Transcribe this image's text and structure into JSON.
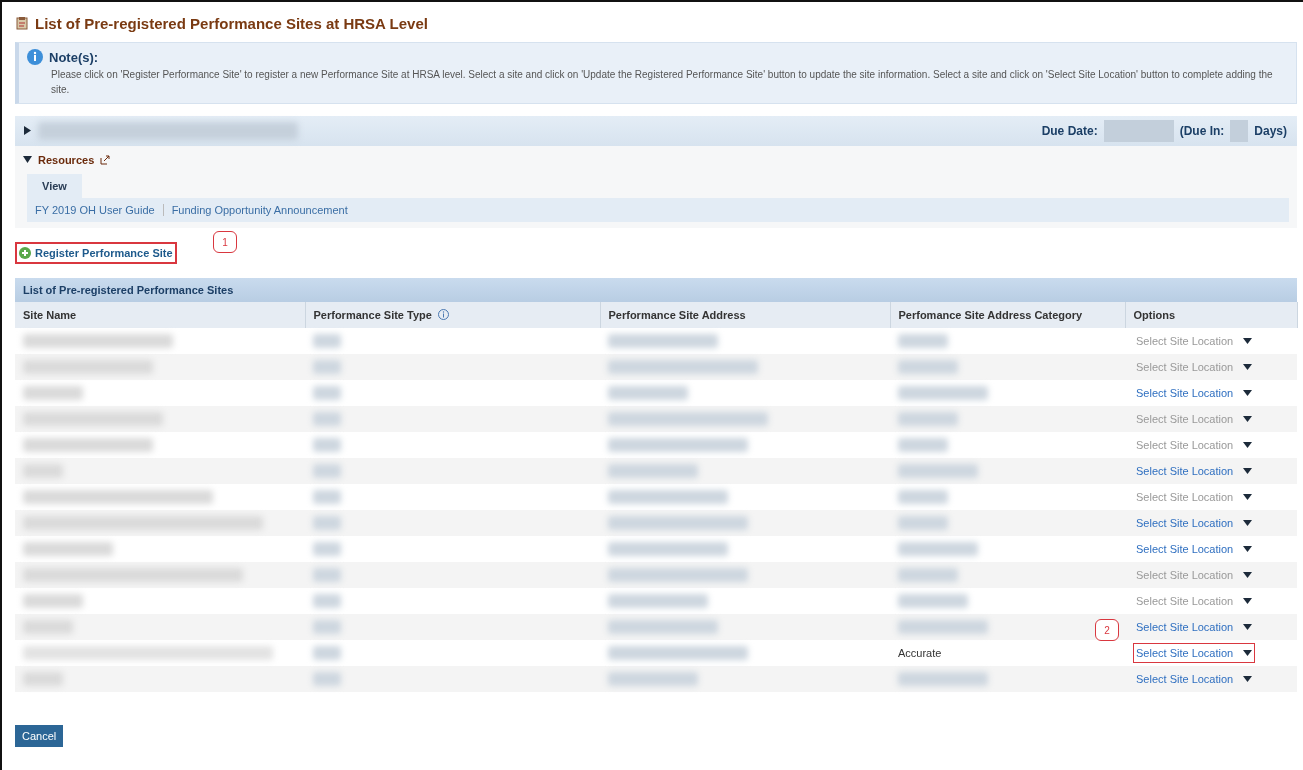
{
  "page": {
    "title": "List of Pre-registered Performance Sites at HRSA Level"
  },
  "note": {
    "heading": "Note(s):",
    "text": "Please click on 'Register Performance Site' to register a new Performance Site at HRSA level. Select a site and click on 'Update the Registered Performance Site' button to update the site information. Select a site and click on 'Select Site Location' button to complete adding the site."
  },
  "summary_bar": {
    "expanded": false,
    "due_date_label": "Due Date:",
    "due_in_label": "(Due In:",
    "days_label": "Days)"
  },
  "resources": {
    "title": "Resources",
    "expanded": true,
    "tab": "View",
    "links": [
      "FY 2019 OH User Guide",
      "Funding Opportunity Announcement"
    ]
  },
  "register_button": {
    "label": "Register Performance Site",
    "callout": "1"
  },
  "table": {
    "title": "List of Pre-registered Performance Sites",
    "columns": [
      "Site Name",
      "Performance Site Type",
      "Performance Site Address",
      "Perfomance Site Address Category",
      "Options"
    ],
    "rows": [
      {
        "option": "Select Site Location",
        "disabled": true
      },
      {
        "option": "Select Site Location",
        "disabled": true
      },
      {
        "option": "Select Site Location",
        "disabled": false
      },
      {
        "option": "Select Site Location",
        "disabled": true
      },
      {
        "option": "Select Site Location",
        "disabled": true
      },
      {
        "option": "Select Site Location",
        "disabled": false
      },
      {
        "option": "Select Site Location",
        "disabled": true
      },
      {
        "option": "Select Site Location",
        "disabled": false
      },
      {
        "option": "Select Site Location",
        "disabled": false
      },
      {
        "option": "Select Site Location",
        "disabled": true
      },
      {
        "option": "Select Site Location",
        "disabled": true
      },
      {
        "option": "Select Site Location",
        "disabled": false
      },
      {
        "option": "Select Site Location",
        "disabled": false,
        "category": "Accurate",
        "callout": "2"
      },
      {
        "option": "Select Site Location",
        "disabled": false
      }
    ]
  },
  "cancel_button": {
    "label": "Cancel"
  }
}
